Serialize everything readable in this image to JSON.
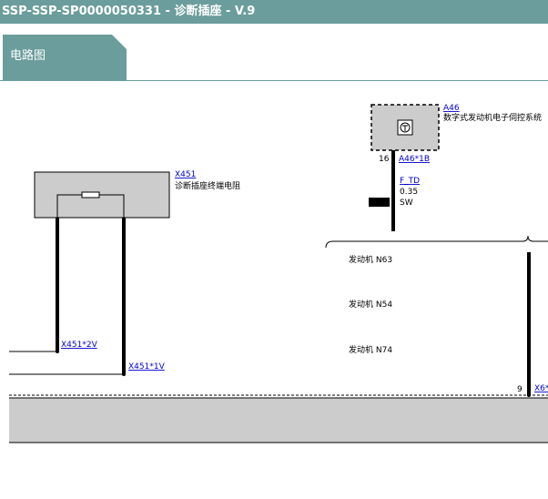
{
  "window": {
    "title": "SSP-SSP-SP0000050331 - 诊断插座 - V.9"
  },
  "tabs": [
    {
      "label": "电路图"
    }
  ],
  "components": {
    "a46": {
      "id": "A46",
      "name": "数字式发动机电子伺控系统",
      "pin_number": "16",
      "pin_ref": "A46*1B"
    },
    "x451": {
      "id": "X451",
      "name": "诊断插座终端电阻",
      "pin_2v": "X451*2V",
      "pin_1v": "X451*1V"
    },
    "x6": {
      "pin_number": "9",
      "pin_ref": "X6*"
    }
  },
  "wire": {
    "signal": "F_TD",
    "gauge": "0.35",
    "color": "SW"
  },
  "variants": [
    "发动机 N63",
    "发动机 N54",
    "发动机 N74"
  ],
  "colors": {
    "header": "#6a9d9b",
    "component_fill": "#cccccc",
    "link": "#0000cc"
  }
}
